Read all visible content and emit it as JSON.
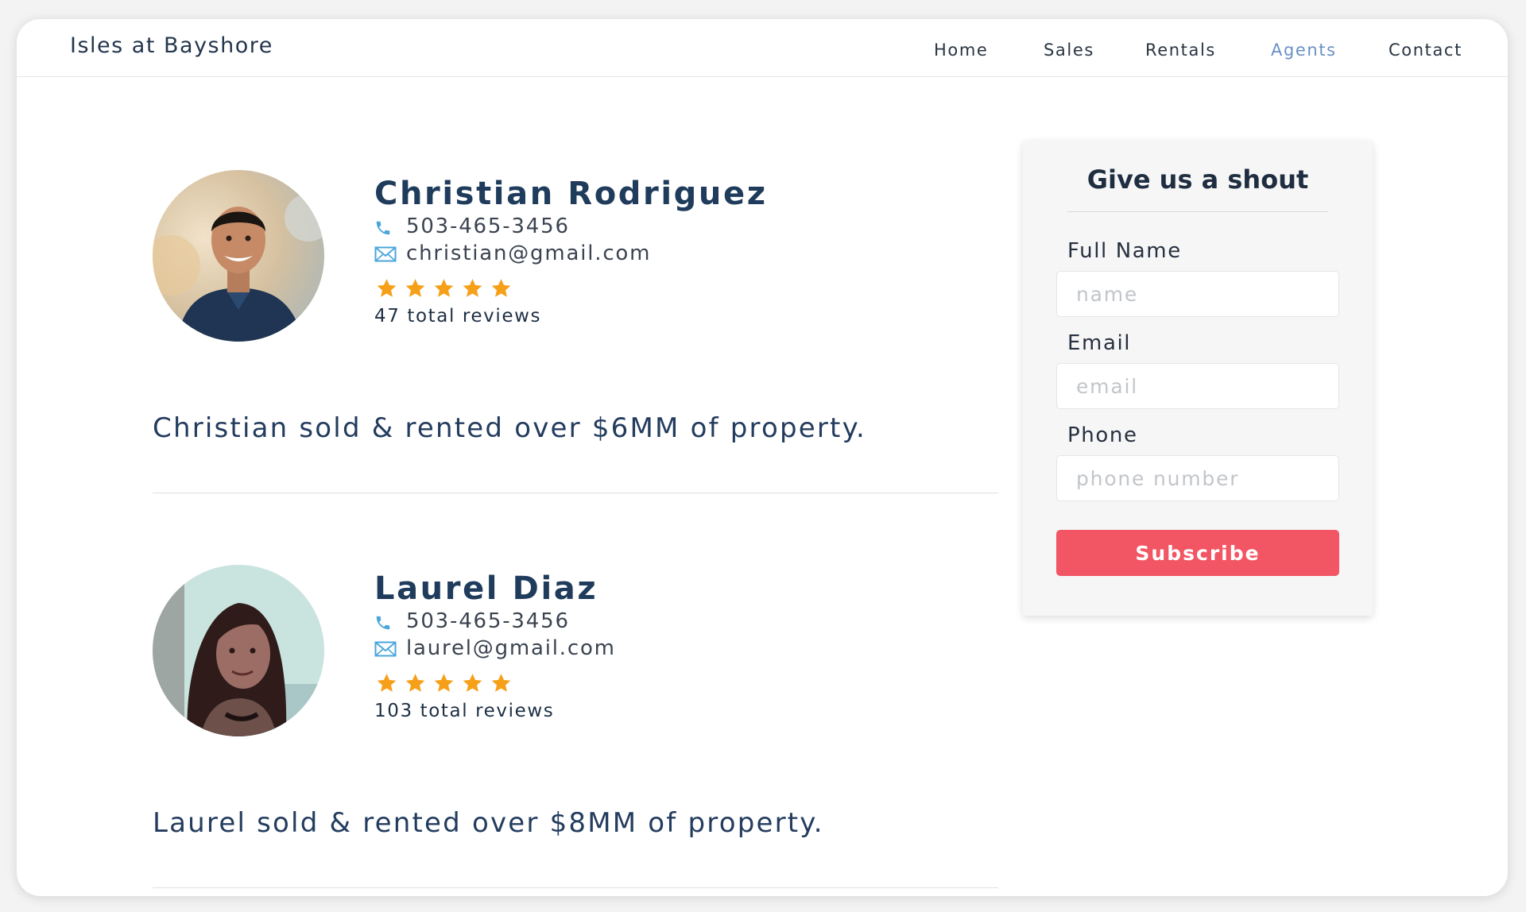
{
  "site": {
    "brand": "Isles at Bayshore"
  },
  "nav": {
    "items": [
      {
        "label": "Home"
      },
      {
        "label": "Sales"
      },
      {
        "label": "Rentals"
      },
      {
        "label": "Agents"
      },
      {
        "label": "Contact"
      }
    ],
    "active": "Agents"
  },
  "agents": [
    {
      "name": "Christian Rodriguez",
      "phone": "503-465-3456",
      "email": "christian@gmail.com",
      "rating": 5,
      "reviews": "47 total reviews",
      "summary": "Christian sold & rented over $6MM of property."
    },
    {
      "name": "Laurel Diaz",
      "phone": "503-465-3456",
      "email": "laurel@gmail.com",
      "rating": 5,
      "reviews": "103 total reviews",
      "summary": "Laurel sold & rented over $8MM of property."
    }
  ],
  "form": {
    "title": "Give us a shout",
    "fields": [
      {
        "label": "Full Name",
        "placeholder": "name"
      },
      {
        "label": "Email",
        "placeholder": "email"
      },
      {
        "label": "Phone",
        "placeholder": "phone number"
      }
    ],
    "submit": "Subscribe"
  },
  "colors": {
    "brand_text": "#24364d",
    "nav_active": "#6a90c4",
    "heading": "#203c5c",
    "star": "#f6a019",
    "icon_blue": "#4aa6dc",
    "button": "#f25563"
  }
}
